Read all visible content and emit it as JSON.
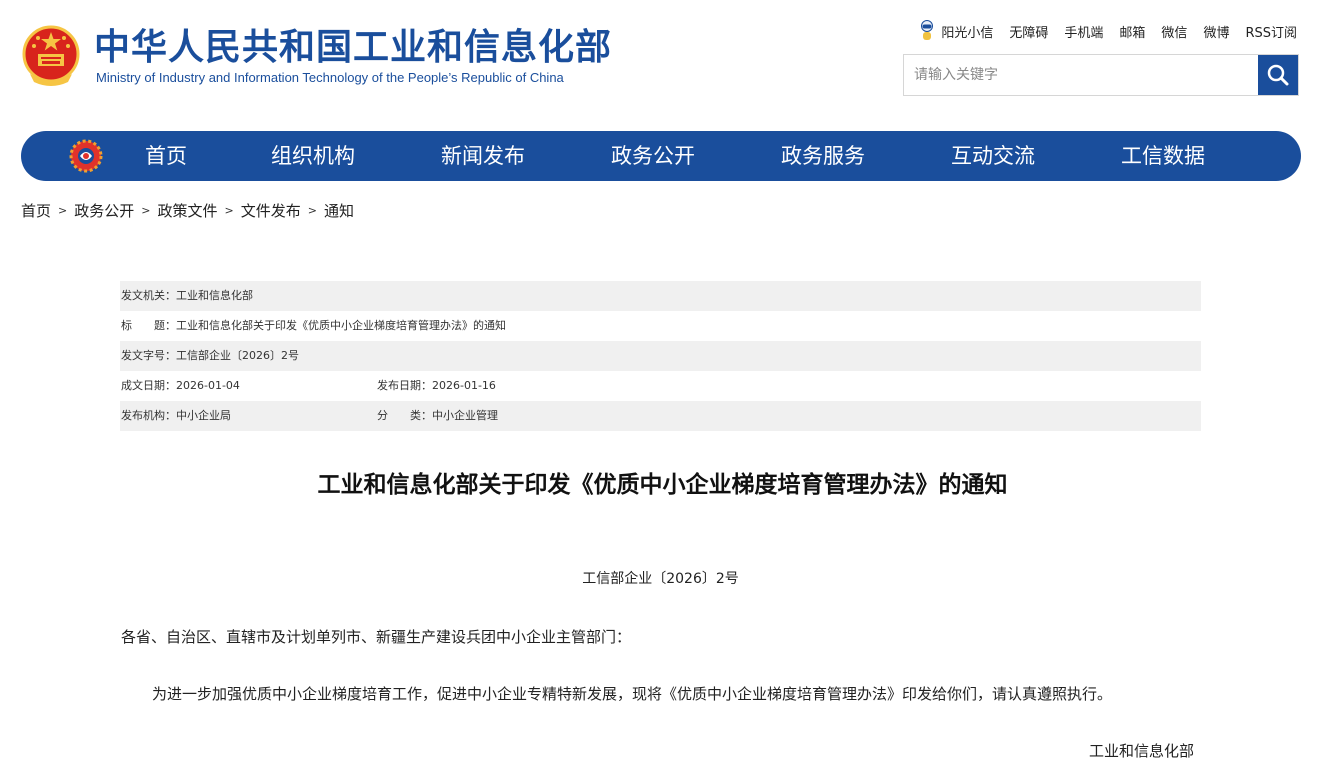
{
  "header": {
    "title_cn": "中华人民共和国工业和信息化部",
    "title_en": "Ministry of Industry and Information Technology of the People’s Republic of China",
    "links": [
      "阳光小信",
      "无障碍",
      "手机端",
      "邮箱",
      "微信",
      "微博",
      "RSS订阅"
    ],
    "search_placeholder": "请输入关键字"
  },
  "nav": {
    "items": [
      "首页",
      "组织机构",
      "新闻发布",
      "政务公开",
      "政务服务",
      "互动交流",
      "工信数据"
    ]
  },
  "breadcrumb": [
    "首页",
    "政务公开",
    "政策文件",
    "文件发布",
    "通知"
  ],
  "meta": {
    "issuer_label": "发文机关：",
    "issuer": "工业和信息化部",
    "title_label": "标　　题：",
    "title": "工业和信息化部关于印发《优质中小企业梯度培育管理办法》的通知",
    "docno_label": "发文字号：",
    "docno": "工信部企业〔2026〕2号",
    "created_label": "成文日期：",
    "created": "2026-01-04",
    "published_label": "发布日期：",
    "published": "2026-01-16",
    "org_label": "发布机构：",
    "org": "中小企业局",
    "category_label": "分　　类：",
    "category": "中小企业管理"
  },
  "document": {
    "title": "工业和信息化部关于印发《优质中小企业梯度培育管理办法》的通知",
    "doc_number": "工信部企业〔2026〕2号",
    "salutation": "各省、自治区、直辖市及计划单列市、新疆生产建设兵团中小企业主管部门：",
    "body": "为进一步加强优质中小企业梯度培育工作，促进中小企业专精特新发展，现将《优质中小企业梯度培育管理办法》印发给你们，请认真遵照执行。",
    "signature": "工业和信息化部"
  },
  "colors": {
    "brand": "#1a4e9c",
    "meta_row": "#f0f0f0",
    "emblem_red": "#d8241c",
    "emblem_gold": "#f6c544"
  }
}
